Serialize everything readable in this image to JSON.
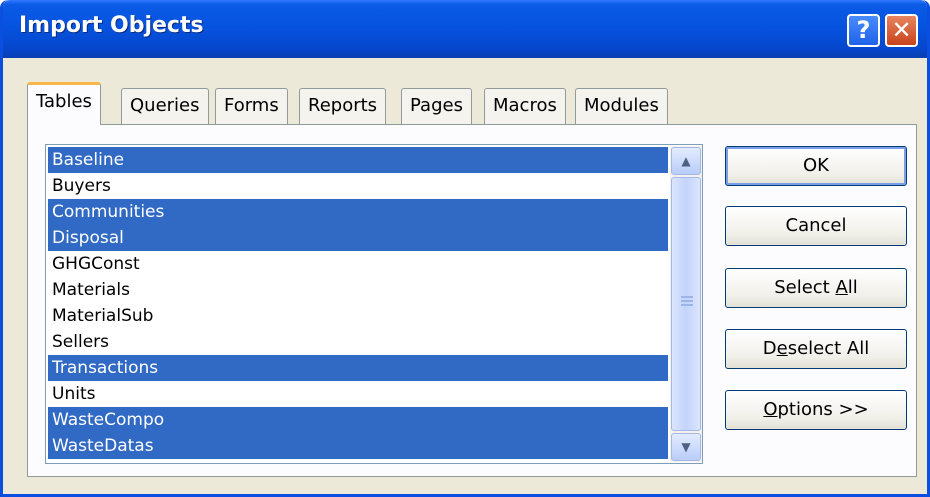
{
  "window": {
    "title": "Import Objects",
    "help_glyph": "?",
    "close_glyph": "✕"
  },
  "tabs": [
    {
      "label": "Tables",
      "active": true
    },
    {
      "label": "Queries",
      "active": false
    },
    {
      "label": "Forms",
      "active": false
    },
    {
      "label": "Reports",
      "active": false
    },
    {
      "label": "Pages",
      "active": false
    },
    {
      "label": "Macros",
      "active": false
    },
    {
      "label": "Modules",
      "active": false
    }
  ],
  "list": {
    "items": [
      {
        "label": "Baseline",
        "selected": true
      },
      {
        "label": "Buyers",
        "selected": false
      },
      {
        "label": "Communities",
        "selected": true
      },
      {
        "label": "Disposal",
        "selected": true
      },
      {
        "label": "GHGConst",
        "selected": false
      },
      {
        "label": "Materials",
        "selected": false
      },
      {
        "label": "MaterialSub",
        "selected": false
      },
      {
        "label": "Sellers",
        "selected": false
      },
      {
        "label": "Transactions",
        "selected": true
      },
      {
        "label": "Units",
        "selected": false
      },
      {
        "label": "WasteCompo",
        "selected": true
      },
      {
        "label": "WasteDatas",
        "selected": true
      }
    ],
    "scroll_up_glyph": "▲",
    "scroll_down_glyph": "▼"
  },
  "buttons": {
    "ok": "OK",
    "cancel": "Cancel",
    "select_all": {
      "before": "Select ",
      "mnemonic": "A",
      "after": "ll"
    },
    "deselect_all": {
      "before": "D",
      "mnemonic": "e",
      "after": "select All"
    },
    "options": {
      "before": "",
      "mnemonic": "O",
      "after": "ptions >>"
    }
  },
  "colors": {
    "titlebar": "#0653e0",
    "selection": "#316ac5",
    "dialog_face": "#ece9d8",
    "active_tab_accent": "#f7b64a"
  }
}
